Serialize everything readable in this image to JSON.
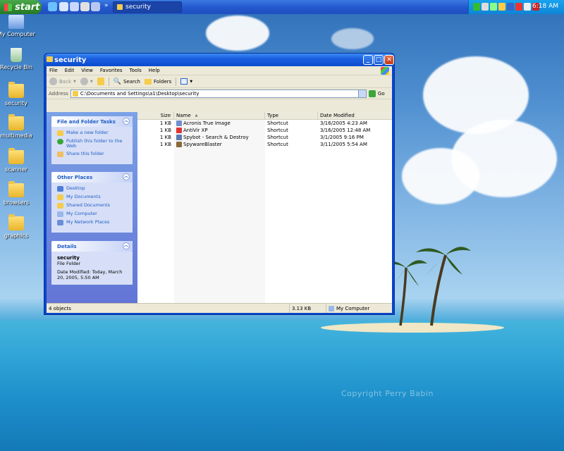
{
  "taskbar": {
    "start_label": "start",
    "task_button_label": "security",
    "clock": "6:18 AM"
  },
  "desktop": {
    "icons": [
      {
        "label": "My Computer"
      },
      {
        "label": "Recycle Bin"
      },
      {
        "label": "security"
      },
      {
        "label": "multimedia"
      },
      {
        "label": "scanner"
      },
      {
        "label": "browsers"
      },
      {
        "label": "graphics"
      }
    ],
    "watermark": "Copyright  Perry Babin"
  },
  "window": {
    "title": "security",
    "menu": [
      "File",
      "Edit",
      "View",
      "Favorites",
      "Tools",
      "Help"
    ],
    "toolbar": {
      "back": "Back",
      "search": "Search",
      "folders": "Folders"
    },
    "address": {
      "label": "Address",
      "value": "C:\\Documents and Settings\\a1\\Desktop\\security",
      "go": "Go"
    },
    "tasks": {
      "file_folder": {
        "title": "File and Folder Tasks",
        "items": [
          "Make a new folder",
          "Publish this folder to the Web",
          "Share this folder"
        ]
      },
      "other_places": {
        "title": "Other Places",
        "items": [
          "Desktop",
          "My Documents",
          "Shared Documents",
          "My Computer",
          "My Network Places"
        ]
      },
      "details": {
        "title": "Details",
        "name": "security",
        "kind": "File Folder",
        "modified": "Date Modified: Today, March 20, 2005, 5:50 AM"
      }
    },
    "columns": {
      "size": "Size",
      "name": "Name",
      "type": "Type",
      "date": "Date Modified"
    },
    "files": [
      {
        "size": "1 KB",
        "name": "Acronis True Image",
        "type": "Shortcut",
        "date": "3/16/2005 4:23 AM"
      },
      {
        "size": "1 KB",
        "name": "AntiVir XP",
        "type": "Shortcut",
        "date": "3/16/2005 12:48 AM"
      },
      {
        "size": "1 KB",
        "name": "Spybot - Search & Destroy",
        "type": "Shortcut",
        "date": "3/1/2005 9:16 PM"
      },
      {
        "size": "1 KB",
        "name": "SpywareBlaster",
        "type": "Shortcut",
        "date": "3/11/2005 5:54 AM"
      }
    ],
    "status": {
      "objects": "4 objects",
      "size": "3.13 KB",
      "zone": "My Computer"
    }
  }
}
